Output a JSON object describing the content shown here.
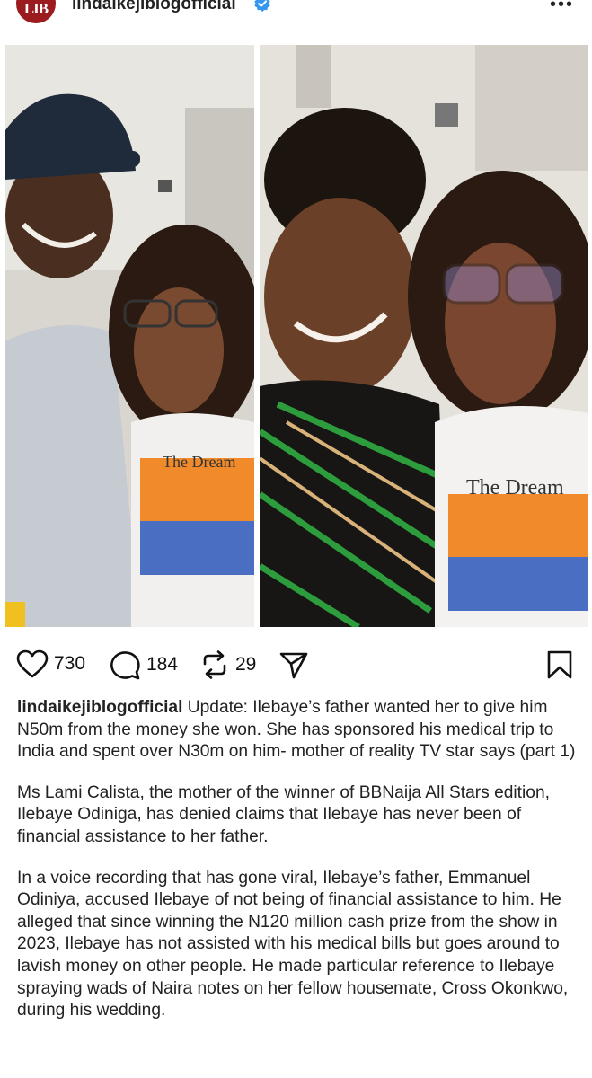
{
  "header": {
    "avatar_text": "LIB",
    "username": "lindaikejiblogofficial",
    "more_label": "•••"
  },
  "photos": [
    {
      "description": "left photo"
    },
    {
      "description": "right photo"
    }
  ],
  "shirt_print": "The Dream",
  "actions": {
    "likes": "730",
    "comments": "184",
    "reposts": "29"
  },
  "caption": {
    "author": "lindaikejiblogofficial",
    "headline": " Update: Ilebaye’s father wanted her to give him N50m from the money she won. She has sponsored his medical trip to India and spent over N30m on him- mother of reality TV star says (part 1)",
    "paragraph_1": "Ms Lami Calista, the mother of the winner of BBNaija All Stars edition, Ilebaye Odiniga, has denied claims that Ilebaye has never been of financial assistance to her father.",
    "paragraph_2": "In a voice recording that has gone viral, Ilebaye’s father, Emmanuel Odiniya, accused Ilebaye of not being of financial assistance to him. He alleged that since winning the N120 million cash prize from the show in 2023, Ilebaye has not assisted with his medical bills but goes around to lavish money on other people. He made particular reference to Ilebaye spraying wads of Naira notes on her fellow housemate, Cross Okonkwo, during his wedding."
  },
  "colors": {
    "brand_red": "#9b1b1e",
    "verified_blue": "#3797f0"
  }
}
